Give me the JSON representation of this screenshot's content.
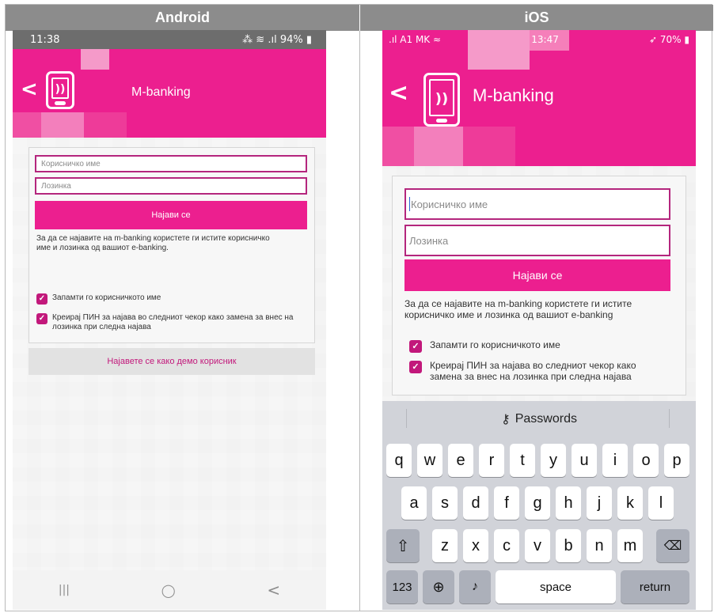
{
  "headers": {
    "android": "Android",
    "ios": "iOS"
  },
  "android": {
    "status": {
      "time": "11:38",
      "indicators": "⁂ ≋ .ıl 94% ▮"
    },
    "banner_title": "M-banking",
    "username_placeholder": "Корисничко име",
    "password_placeholder": "Лозинка",
    "login_label": "Најави се",
    "info_text": "За да се најавите на m-banking користете ги истите корисничко име и лозинка од вашиот e-banking.",
    "remember_label": "Запамти го корисничкото име",
    "pin_label": "Креирај ПИН за најава во следниот чекор како замена за внес на лозинка при следна најава",
    "demo_label": "Најавете се како демо корисник",
    "nav": {
      "recents": "|||",
      "home": "◯",
      "back": "<"
    }
  },
  "ios": {
    "status": {
      "carrier": "A1 MK",
      "time": "13:47",
      "battery": "70%"
    },
    "banner_title": "M-banking",
    "username_placeholder": "Корисничко име",
    "password_placeholder": "Лозинка",
    "login_label": "Најави се",
    "info_text": "За да се најавите на m-banking користете ги истите корисничко име и лозинка од вашиот e-banking",
    "remember_label": "Запамти го корисничкото име",
    "pin_label": "Креирај ПИН за најава во следниот чекор како замена за внес на лозинка при следна најава",
    "keyboard": {
      "passwords_label": "Passwords",
      "row1": [
        "q",
        "w",
        "e",
        "r",
        "t",
        "y",
        "u",
        "i",
        "o",
        "p"
      ],
      "row2": [
        "a",
        "s",
        "d",
        "f",
        "g",
        "h",
        "j",
        "k",
        "l"
      ],
      "row3": [
        "z",
        "x",
        "c",
        "v",
        "b",
        "n",
        "m"
      ],
      "num_label": "123",
      "space_label": "space",
      "return_label": "return"
    }
  },
  "colors": {
    "brand": "#ec1f8f",
    "border": "#b4267d",
    "check": "#c2187b"
  }
}
